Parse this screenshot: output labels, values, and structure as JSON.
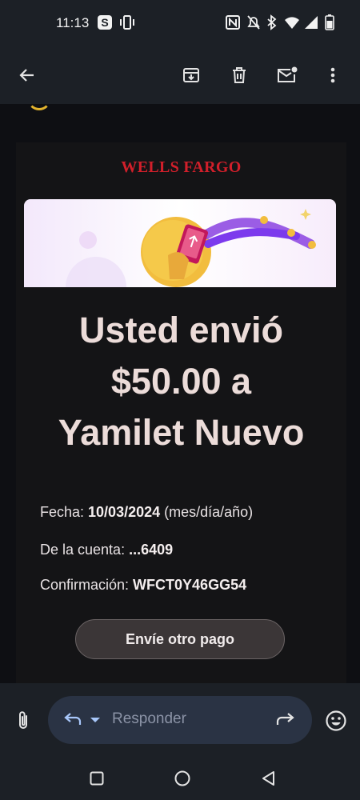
{
  "status_bar": {
    "time": "11:13",
    "icons": [
      "s-app-icon",
      "vibrate-icon",
      "nfc-icon",
      "mute-icon",
      "bluetooth-icon",
      "wifi-icon",
      "signal-icon",
      "battery-icon"
    ]
  },
  "app_bar": {
    "actions": [
      "back-arrow-icon",
      "archive-icon",
      "delete-icon",
      "mark-unread-icon",
      "more-vert-icon"
    ]
  },
  "email": {
    "brand": "WELLS FARGO",
    "headline": [
      "Usted envió",
      "$50.00 a",
      "Yamilet Nuevo"
    ],
    "date_label": "Fecha: ",
    "date_value": "10/03/2024",
    "date_suffix": " (mes/día/año)",
    "account_label": "De la cuenta: ",
    "account_value": "...6409",
    "confirmation_label": "Confirmación: ",
    "confirmation_value": "WFCT0Y46GG54",
    "cta_label": "Envíe otro pago"
  },
  "reply_bar": {
    "placeholder": "Responder"
  },
  "colors": {
    "brand_red": "#d11f2a",
    "background": "#0e0f13",
    "bar": "#1c2026",
    "pill": "#2a3344",
    "accent_blue": "#a8c7fa"
  }
}
